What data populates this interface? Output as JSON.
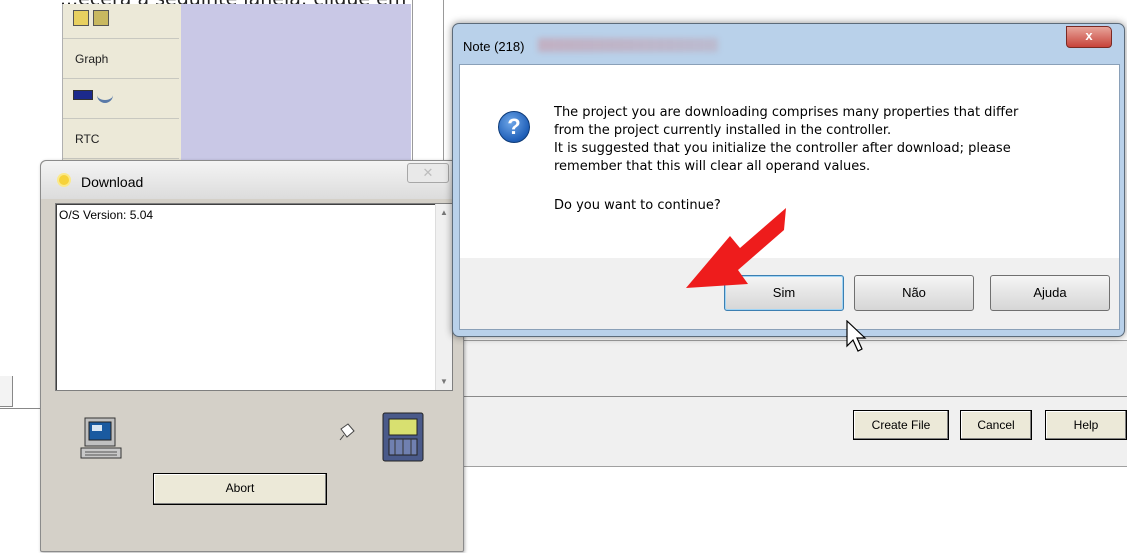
{
  "header": {
    "text": "...ecerá a seguinte janela: clique em OK"
  },
  "toolbar": {
    "items": [
      {
        "label": "Graph"
      },
      {
        "label": "RTC"
      }
    ]
  },
  "bg_window": {
    "create_file": "Create File",
    "cancel": "Cancel",
    "help": "Help"
  },
  "download": {
    "title": "Download",
    "close_glyph": "✕",
    "log_line": "O/S Version: 5.04",
    "abort": "Abort"
  },
  "note": {
    "title": "Note (218)",
    "close_glyph": "x",
    "icon_glyph": "?",
    "line1": "The project you are downloading comprises many properties that differ",
    "line2": "from the project currently installed in the controller.",
    "line3": "It is suggested that you initialize the controller after download; please",
    "line4": "remember that this will clear all operand values.",
    "line5": "Do you want to continue?",
    "buttons": {
      "yes": "Sim",
      "no": "Não",
      "help": "Ajuda"
    }
  },
  "colors": {
    "arrow": "#ee1c1c",
    "dialog_frame": "#b9d1ea",
    "toolbar_panel": "#c9c8e6"
  }
}
